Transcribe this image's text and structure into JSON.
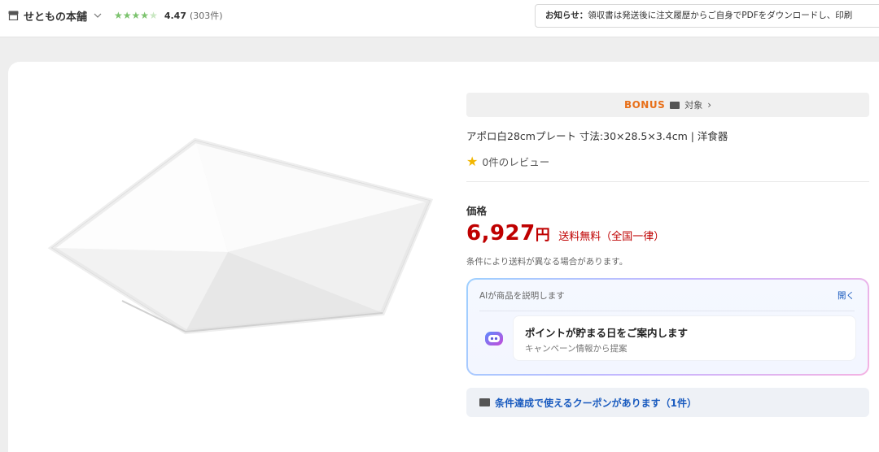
{
  "header": {
    "shop_name": "せともの本舗",
    "rating_score": "4.47",
    "rating_count": "(303件)",
    "stars": 4.47,
    "notice_label": "お知らせ：",
    "notice_text": "領収書は発送後に注文履歴からご自身でPDFをダウンロードし、印刷"
  },
  "product": {
    "bonus_logo": "BONUS",
    "bonus_text": "対象",
    "title": "アポロ白28cmプレート 寸法:30×28.5×3.4cm | 洋食器",
    "reviews": "0件のレビュー",
    "price_label": "価格",
    "price": "6,927",
    "currency": "円",
    "shipping": "送料無料（全国一律）",
    "shipping_note": "条件により送料が異なる場合があります。"
  },
  "ai": {
    "heading": "AIが商品を説明します",
    "open_label": "開く",
    "card_title": "ポイントが貯まる日をご案内します",
    "card_sub": "キャンペーン情報から提案"
  },
  "coupon": {
    "label": "条件達成で使えるクーポンがあります（1件）"
  },
  "colors": {
    "price": "#bf0000",
    "link": "#1a5bbf",
    "rating_star": "#7cc36e",
    "bonus": "#e8701a"
  }
}
